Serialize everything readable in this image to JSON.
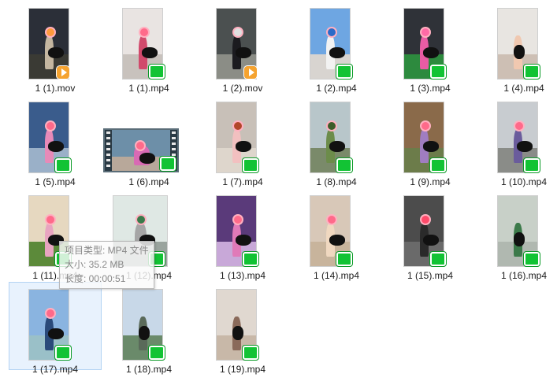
{
  "files": [
    {
      "name": "1 (1).mov",
      "badge": "mov",
      "sky": "#2b2f38",
      "ground": "#3a3a34",
      "figure": "#c4b6a0",
      "accent": "#ff9a3c"
    },
    {
      "name": "1 (1).mp4",
      "badge": "iqiyi",
      "sky": "#e9e4e2",
      "ground": "#c8c2bd",
      "figure": "#d14a6c",
      "accent": "#ff6a8a"
    },
    {
      "name": "1 (2).mov",
      "badge": "mov",
      "sky": "#4b5050",
      "ground": "#8b8d86",
      "figure": "#1b1b1f",
      "accent": "#e0e0e0"
    },
    {
      "name": "1 (2).mp4",
      "badge": "iqiyi",
      "sky": "#6ea6e2",
      "ground": "#d8d4d0",
      "figure": "#f2f2f2",
      "accent": "#2a6ac8"
    },
    {
      "name": "1 (3).mp4",
      "badge": "iqiyi",
      "sky": "#2f3238",
      "ground": "#2d8a3e",
      "figure": "#e85ca4",
      "accent": "#ff6aa6"
    },
    {
      "name": "1 (4).mp4",
      "badge": "iqiyi",
      "sky": "#e8e5e1",
      "ground": "#cdbfb4",
      "figure": "#f0c8b0",
      "accent": "#111111"
    },
    {
      "name": "1 (5).mp4",
      "badge": "iqiyi",
      "sky": "#3a5c8c",
      "ground": "#9ab0c8",
      "figure": "#e78ab8",
      "accent": "#ff6a8a"
    },
    {
      "name": "1 (6).mp4",
      "badge": "iqiyi",
      "landscape": true,
      "sky": "#6d8fa8",
      "ground": "#b8a89a",
      "figure": "#d86ab4",
      "accent": "#ff6a8a"
    },
    {
      "name": "1 (7).mp4",
      "badge": "iqiyi",
      "sky": "#c8c0b8",
      "ground": "#ded6cc",
      "figure": "#f2c0c0",
      "accent": "#b2462a"
    },
    {
      "name": "1 (8).mp4",
      "badge": "iqiyi",
      "sky": "#b8c6ca",
      "ground": "#7a8a6a",
      "figure": "#6c8c4a",
      "accent": "#3c5c2a"
    },
    {
      "name": "1 (9).mp4",
      "badge": "iqiyi",
      "sky": "#8a6a4a",
      "ground": "#6c7c4a",
      "figure": "#a07dc0",
      "accent": "#ff6a8a"
    },
    {
      "name": "1 (10).mp4",
      "badge": "iqiyi",
      "sky": "#c8ccd0",
      "ground": "#8a8c88",
      "figure": "#6a5c9c",
      "accent": "#ff6a8a"
    },
    {
      "name": "1 (11).mp4",
      "badge": "iqiyi",
      "sky": "#e6d8c0",
      "ground": "#5c8a3a",
      "figure": "#e8a4c0",
      "accent": "#ff6a8a"
    },
    {
      "name": "1 (12).mp4",
      "badge": "iqiyi",
      "wide": true,
      "sky": "#dfe8e4",
      "ground": "#9aa49e",
      "figure": "#a6a6a6",
      "accent": "#3a7a4a"
    },
    {
      "name": "1 (13).mp4",
      "badge": "iqiyi",
      "sky": "#5a3a7a",
      "ground": "#c8a8d8",
      "figure": "#e07ab8",
      "accent": "#ff6a8a"
    },
    {
      "name": "1 (14).mp4",
      "badge": "iqiyi",
      "sky": "#d8c8b8",
      "ground": "#c8b49c",
      "figure": "#f0d8c0",
      "accent": "#ff6a8a"
    },
    {
      "name": "1 (15).mp4",
      "badge": "iqiyi",
      "sky": "#4c4c4c",
      "ground": "#6a6a6a",
      "figure": "#2a2a2a",
      "accent": "#ff4a6a"
    },
    {
      "name": "1 (16).mp4",
      "badge": "iqiyi",
      "sky": "#c8d0c8",
      "ground": "#b0b8b0",
      "figure": "#3c7a4a",
      "accent": "#111111"
    },
    {
      "name": "1 (17).mp4",
      "badge": "iqiyi",
      "selected": true,
      "sky": "#8ab4e0",
      "ground": "#9ac0c8",
      "figure": "#2a4a7a",
      "accent": "#ff6a8a"
    },
    {
      "name": "1 (18).mp4",
      "badge": "iqiyi",
      "sky": "#c8d8e8",
      "ground": "#6a8a6a",
      "figure": "#5a6a5a",
      "accent": "#111111"
    },
    {
      "name": "1 (19).mp4",
      "badge": "iqiyi",
      "sky": "#e0d8d0",
      "ground": "#c8b8a8",
      "figure": "#8a6a5a",
      "accent": "#111111"
    }
  ],
  "tooltip": {
    "type_line": "项目类型: MP4 文件",
    "size_line": "大小: 35.2 MB",
    "duration_line": "长度: 00:00:51"
  }
}
